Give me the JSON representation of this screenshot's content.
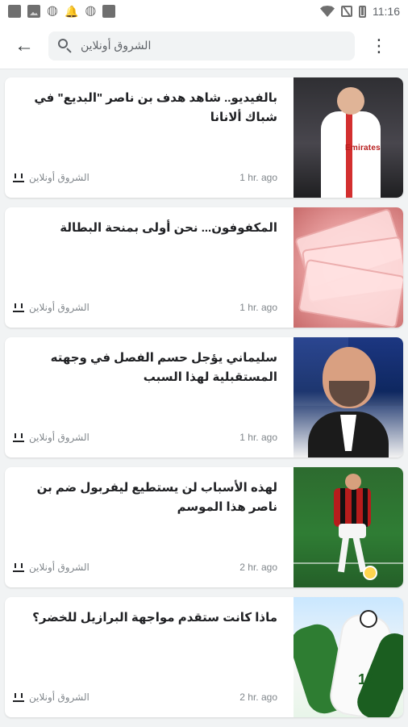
{
  "status_bar": {
    "time": "11:16"
  },
  "app_bar": {
    "search_text": "الشروق أونلاين"
  },
  "articles": [
    {
      "title": "بالفيديو.. شاهد هدف بن ناصر \"البديع\" في شباك ألانانا",
      "source": "الشروق أونلاين",
      "time": "1 hr. ago",
      "thumb_text": "Emirates"
    },
    {
      "title": "المكفوفون... نحن أولى بمنحة البطالة",
      "source": "الشروق أونلاين",
      "time": "1 hr. ago"
    },
    {
      "title": "سليماني يؤجل حسم الفصل في وجهته المستقبلية لهذا السبب",
      "source": "الشروق أونلاين",
      "time": "1 hr. ago"
    },
    {
      "title": "لهذه الأسباب لن يستطيع ليفربول ضم بن ناصر هذا الموسم",
      "source": "الشروق أونلاين",
      "time": "2 hr. ago"
    },
    {
      "title": "ماذا كانت ستقدم مواجهة البرازيل للخضر؟",
      "source": "الشروق أونلاين",
      "time": "2 hr. ago"
    }
  ]
}
